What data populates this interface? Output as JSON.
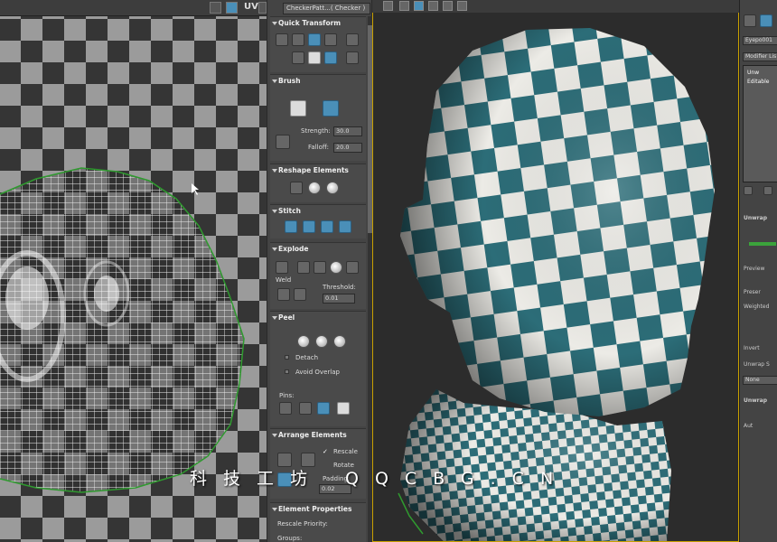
{
  "uv_editor": {
    "toolbar_label": "UV"
  },
  "checker_dropdown": "CheckerPatt...( Checker )",
  "rollouts": {
    "quick_transform": "Quick Transform",
    "brush": "Brush",
    "brush_strength_label": "Strength:",
    "brush_strength": "30.0",
    "brush_falloff_label": "Falloff:",
    "brush_falloff": "20.0",
    "reshape": "Reshape Elements",
    "stitch": "Stitch",
    "explode": "Explode",
    "weld_label": "Weld",
    "threshold_label": "Threshold:",
    "threshold_value": "0.01",
    "peel": "Peel",
    "detach_label": "Detach",
    "avoid_overlap_label": "Avoid Overlap",
    "pins_label": "Pins:",
    "arrange": "Arrange Elements",
    "rescale_label": "Rescale",
    "rotate_label": "Rotate",
    "padding_label": "Padding:",
    "padding_value": "0.02",
    "element_properties": "Element Properties",
    "rescale_priority_label": "Rescale Priority:",
    "groups_label": "Groups:"
  },
  "command_panel": {
    "object_name": "Eyepo001",
    "modifier_list": "Modifier Lis",
    "stack_item_1": "Unw",
    "stack_item_2": "Editable",
    "unwrap_rollout": "Unwrap",
    "preview_label": "Preview",
    "preserve_label": "Preser",
    "weighted_label": "Weighted",
    "invert_label": "Invert",
    "unwrap_label": "Unwrap S",
    "none_label": "None",
    "unwrap2_label": "Unwrap",
    "auto_label": "Aut"
  },
  "watermark": "科技工坊 QQCBG.CN",
  "colors": {
    "checker_teal": "#2c6d78",
    "checker_white": "#ecebe6",
    "uv_checker_light": "#9b9b9b",
    "uv_checker_dark": "#353535",
    "uv_seam": "#2f9a2f",
    "viewport_border": "#c8a000"
  }
}
